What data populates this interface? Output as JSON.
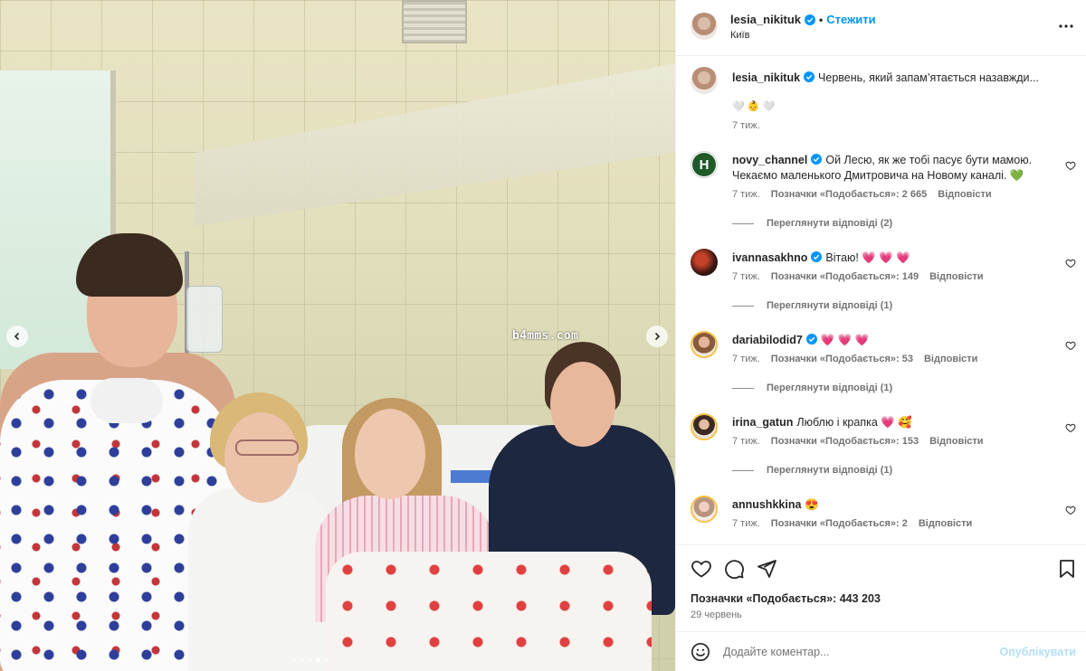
{
  "post": {
    "author": "lesia_nikituk",
    "follow_label": "Стежити",
    "separator": "•",
    "location": "Київ",
    "caption_text": "Червень, який запам’ятається назавжди...",
    "caption_emoji": "🤍 👶 🤍",
    "caption_age": "7 тиж.",
    "watermark": "b4mms.com",
    "carousel_count": 5,
    "carousel_active_index": 3
  },
  "comments": [
    {
      "user": "novy_channel",
      "verified": true,
      "text": "Ой Лесю, як же тобі пасує бути мамою. Чекаємо маленького Дмитровича на Новому каналі. 💚",
      "age": "7 тиж.",
      "likes": "Позначки «Подобається»: 2 665",
      "reply": "Відповісти",
      "view_replies": "Переглянути відповіді (2)"
    },
    {
      "user": "ivannasakhno",
      "verified": true,
      "text": "Вітаю! 💗 💗 💗",
      "age": "7 тиж.",
      "likes": "Позначки «Подобається»: 149",
      "reply": "Відповісти",
      "view_replies": "Переглянути відповіді (1)"
    },
    {
      "user": "dariabilodid7",
      "verified": true,
      "text": "💗 💗 💗",
      "age": "7 тиж.",
      "likes": "Позначки «Подобається»: 53",
      "reply": "Відповісти",
      "view_replies": "Переглянути відповіді (1)"
    },
    {
      "user": "irina_gatun",
      "verified": false,
      "text": "Люблю і крапка 💗 🥰",
      "age": "7 тиж.",
      "likes": "Позначки «Подобається»: 153",
      "reply": "Відповісти",
      "view_replies": "Переглянути відповіді (1)"
    },
    {
      "user": "annushkkina",
      "verified": false,
      "text": "😍",
      "age": "7 тиж.",
      "likes": "Позначки «Подобається»: 2",
      "reply": "Відповісти"
    }
  ],
  "footer": {
    "likes_total": "Позначки «Подобається»: 443 203",
    "date": "29 червень",
    "comment_placeholder": "Додайте коментар...",
    "publish_label": "Опублікувати"
  },
  "icons": {
    "more": "more-horizontal-icon",
    "like": "heart-icon",
    "comment": "comment-icon",
    "share": "send-icon",
    "save": "bookmark-icon",
    "emoji": "emoji-icon",
    "verified": "verified-badge-icon"
  },
  "colors": {
    "accent": "#0095f6",
    "verified": "#0095f6",
    "muted": "#737373",
    "publish_disabled": "#b2dffc"
  }
}
